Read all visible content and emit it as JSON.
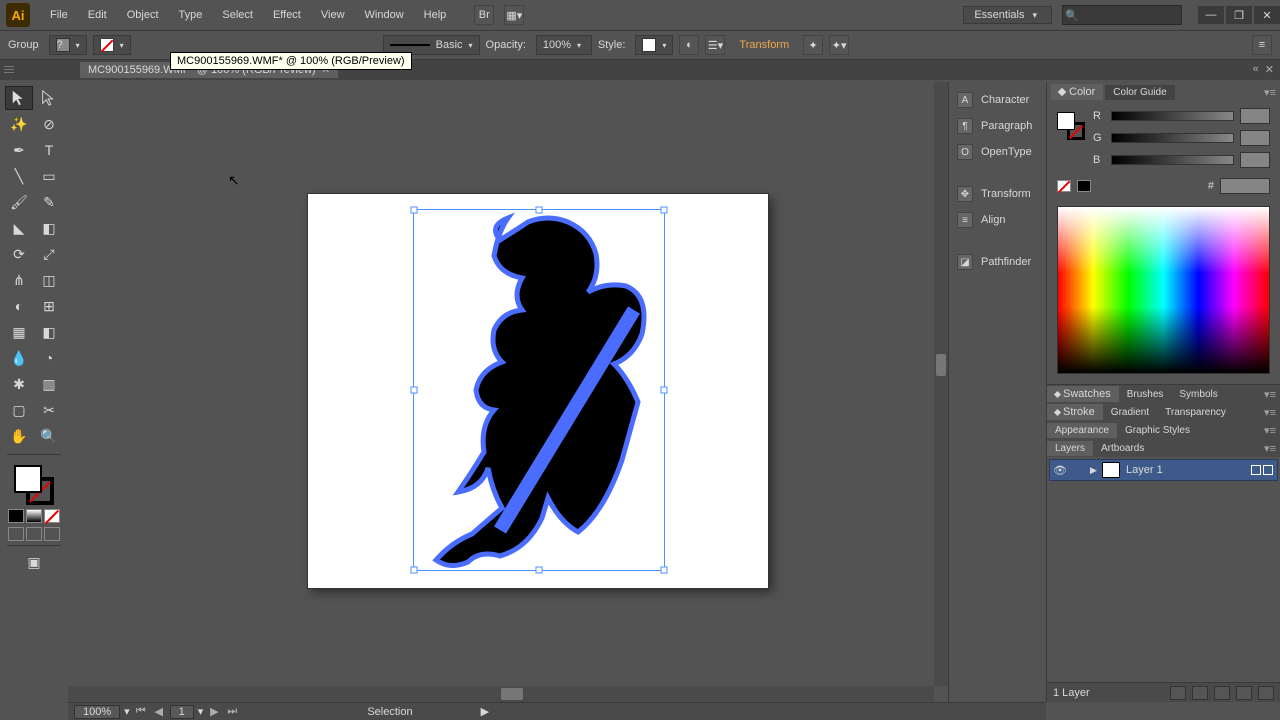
{
  "menus": [
    "File",
    "Edit",
    "Object",
    "Type",
    "Select",
    "Effect",
    "View",
    "Window",
    "Help"
  ],
  "workspace": "Essentials",
  "ctrlbar": {
    "mode": "Group",
    "stroke_style": "Basic",
    "opacity_label": "Opacity:",
    "opacity_value": "100%",
    "style_label": "Style:",
    "transform_link": "Transform"
  },
  "tooltip": "MC900155969.WMF* @ 100% (RGB/Preview)",
  "doc_tab": "MC900155969.WMF* @ 100% (RGB/Preview)",
  "panel_strip": [
    "Character",
    "Paragraph",
    "OpenType",
    "Transform",
    "Align",
    "Pathfinder"
  ],
  "color": {
    "tab_color": "Color",
    "tab_guide": "Color Guide",
    "ch": [
      "R",
      "G",
      "B"
    ],
    "hash": "#"
  },
  "tabrows": {
    "a": [
      "Swatches",
      "Brushes",
      "Symbols"
    ],
    "b": [
      "Stroke",
      "Gradient",
      "Transparency"
    ],
    "c": [
      "Appearance",
      "Graphic Styles"
    ],
    "d": [
      "Layers",
      "Artboards"
    ]
  },
  "layer": {
    "name": "Layer 1",
    "footer": "1 Layer"
  },
  "status": {
    "zoom": "100%",
    "page": "1",
    "tool": "Selection"
  }
}
